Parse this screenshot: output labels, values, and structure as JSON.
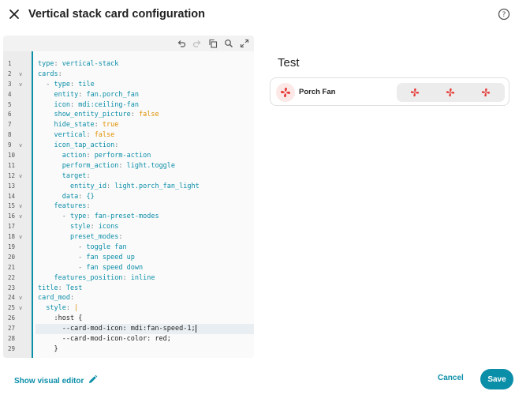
{
  "dialog": {
    "title": "Vertical stack card configuration"
  },
  "toolbar": {
    "icons": [
      "undo-icon",
      "redo-icon",
      "copy-icon",
      "search-icon",
      "fullscreen-icon"
    ]
  },
  "editor": {
    "accent_color": "#0b8ea8",
    "lines": [
      {
        "n": "1",
        "fold": "",
        "indent": "",
        "key": "type",
        "value": "vertical-stack",
        "vtype": "s"
      },
      {
        "n": "2",
        "fold": "v",
        "indent": "",
        "key": "cards",
        "value": "",
        "vtype": ""
      },
      {
        "n": "3",
        "fold": "v",
        "indent": "  - ",
        "key": "type",
        "value": "tile",
        "vtype": "s"
      },
      {
        "n": "4",
        "fold": "",
        "indent": "    ",
        "key": "entity",
        "value": "fan.porch_fan",
        "vtype": "s"
      },
      {
        "n": "5",
        "fold": "",
        "indent": "    ",
        "key": "icon",
        "value": "mdi:ceiling-fan",
        "vtype": "s"
      },
      {
        "n": "6",
        "fold": "",
        "indent": "    ",
        "key": "show_entity_picture",
        "value": "false",
        "vtype": "b"
      },
      {
        "n": "7",
        "fold": "",
        "indent": "    ",
        "key": "hide_state",
        "value": "true",
        "vtype": "b"
      },
      {
        "n": "8",
        "fold": "",
        "indent": "    ",
        "key": "vertical",
        "value": "false",
        "vtype": "b"
      },
      {
        "n": "9",
        "fold": "v",
        "indent": "    ",
        "key": "icon_tap_action",
        "value": "",
        "vtype": ""
      },
      {
        "n": "10",
        "fold": "",
        "indent": "      ",
        "key": "action",
        "value": "perform-action",
        "vtype": "s"
      },
      {
        "n": "11",
        "fold": "",
        "indent": "      ",
        "key": "perform_action",
        "value": "light.toggle",
        "vtype": "s"
      },
      {
        "n": "12",
        "fold": "v",
        "indent": "      ",
        "key": "target",
        "value": "",
        "vtype": ""
      },
      {
        "n": "13",
        "fold": "",
        "indent": "        ",
        "key": "entity_id",
        "value": "light.porch_fan_light",
        "vtype": "s"
      },
      {
        "n": "14",
        "fold": "",
        "indent": "      ",
        "key": "data",
        "value": "{}",
        "vtype": "br"
      },
      {
        "n": "15",
        "fold": "v",
        "indent": "    ",
        "key": "features",
        "value": "",
        "vtype": ""
      },
      {
        "n": "16",
        "fold": "v",
        "indent": "      - ",
        "key": "type",
        "value": "fan-preset-modes",
        "vtype": "s"
      },
      {
        "n": "17",
        "fold": "",
        "indent": "        ",
        "key": "style",
        "value": "icons",
        "vtype": "s"
      },
      {
        "n": "18",
        "fold": "v",
        "indent": "        ",
        "key": "preset_modes",
        "value": "",
        "vtype": ""
      },
      {
        "n": "19",
        "fold": "",
        "indent": "          - ",
        "key": "",
        "value": "toggle fan",
        "vtype": "s"
      },
      {
        "n": "20",
        "fold": "",
        "indent": "          - ",
        "key": "",
        "value": "fan speed up",
        "vtype": "s"
      },
      {
        "n": "21",
        "fold": "",
        "indent": "          - ",
        "key": "",
        "value": "fan speed down",
        "vtype": "s"
      },
      {
        "n": "22",
        "fold": "",
        "indent": "    ",
        "key": "features_position",
        "value": "inline",
        "vtype": "s"
      },
      {
        "n": "23",
        "fold": "",
        "indent": "",
        "key": "title",
        "value": "Test",
        "vtype": "s"
      },
      {
        "n": "24",
        "fold": "v",
        "indent": "",
        "key": "card_mod",
        "value": "",
        "vtype": ""
      },
      {
        "n": "25",
        "fold": "v",
        "indent": "  ",
        "key": "style",
        "value": "|",
        "vtype": "b"
      },
      {
        "n": "26",
        "fold": "",
        "indent": "    ",
        "key": "",
        "value": ":host {",
        "vtype": "t"
      },
      {
        "n": "27",
        "fold": "",
        "indent": "      ",
        "key": "",
        "value": "--card-mod-icon: mdi:fan-speed-1;",
        "vtype": "t",
        "active": true
      },
      {
        "n": "28",
        "fold": "",
        "indent": "      ",
        "key": "",
        "value": "--card-mod-icon-color: red;",
        "vtype": "t"
      },
      {
        "n": "29",
        "fold": "",
        "indent": "    ",
        "key": "",
        "value": "}",
        "vtype": "t"
      }
    ]
  },
  "preview": {
    "title": "Test",
    "tile": {
      "name": "Porch Fan",
      "icon": "fan-icon",
      "icon_color": "#e53935",
      "modes": [
        "fan-speed-icon",
        "fan-speed-icon",
        "fan-speed-icon"
      ]
    }
  },
  "footer": {
    "visual_editor_label": "Show visual editor",
    "cancel_label": "Cancel",
    "save_label": "Save"
  }
}
